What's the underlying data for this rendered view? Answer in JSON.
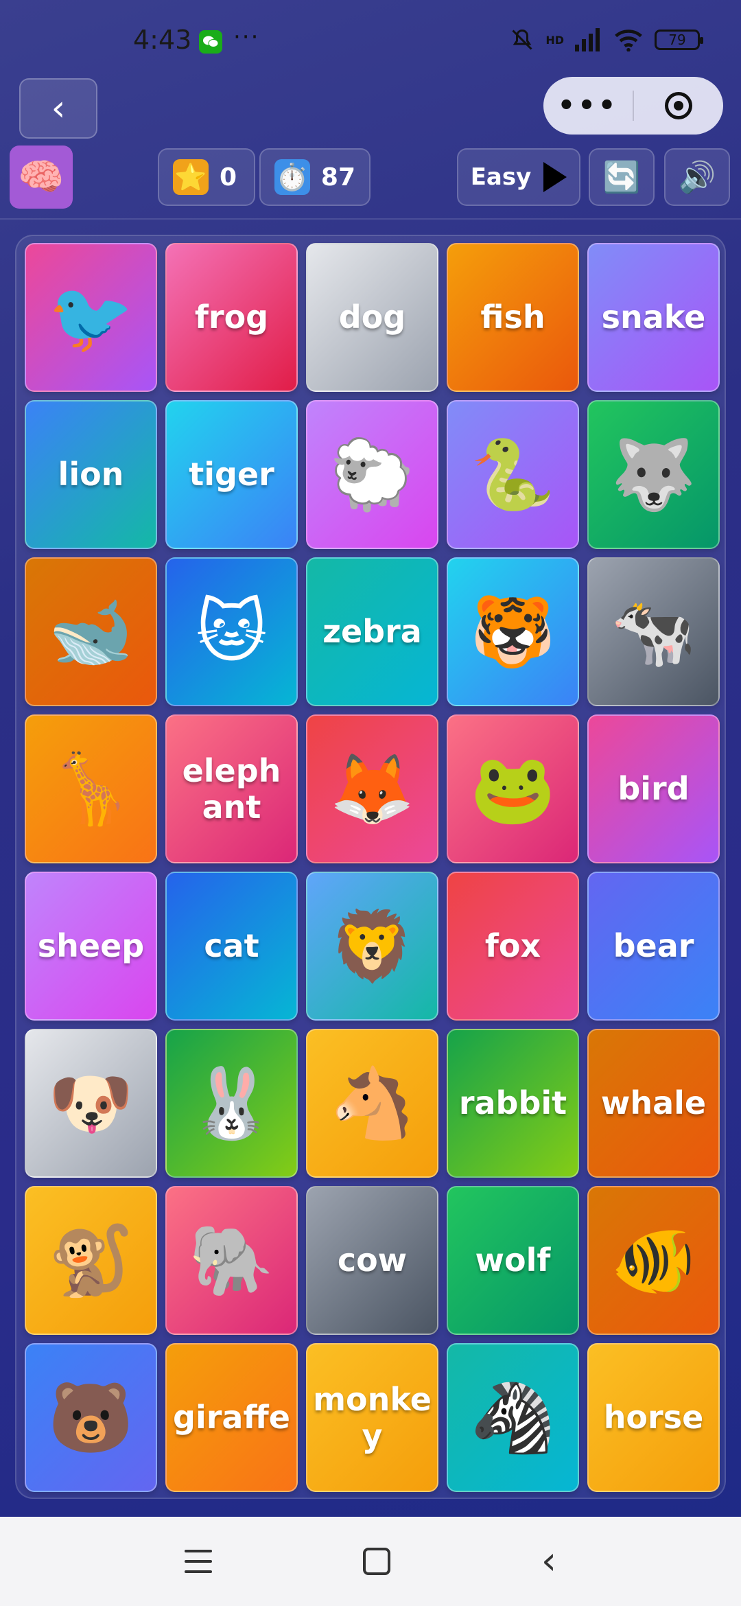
{
  "status_bar": {
    "time": "4:43",
    "dots": "···",
    "network": "HD",
    "battery": "79"
  },
  "header": {
    "back_glyph": "‹",
    "capsule_more": "•••"
  },
  "toolbar": {
    "brain_icon": "🧠",
    "score_icon": "⭐",
    "score": "0",
    "timer_icon": "⏱️",
    "timer": "87",
    "difficulty": "Easy",
    "refresh_icon": "🔄",
    "sound_icon": "🔊"
  },
  "cards": [
    {
      "kind": "emoji",
      "text": "🐦",
      "color": "pinkviolet"
    },
    {
      "kind": "word",
      "text": "frog",
      "color": "pink"
    },
    {
      "kind": "word",
      "text": "dog",
      "color": "silver"
    },
    {
      "kind": "word",
      "text": "fish",
      "color": "orange"
    },
    {
      "kind": "word",
      "text": "snake",
      "color": "violet"
    },
    {
      "kind": "word",
      "text": "lion",
      "color": "blueteal"
    },
    {
      "kind": "word",
      "text": "tiger",
      "color": "sky"
    },
    {
      "kind": "emoji",
      "text": "🐑",
      "color": "purple"
    },
    {
      "kind": "emoji",
      "text": "🐍",
      "color": "violet"
    },
    {
      "kind": "emoji",
      "text": "🐺",
      "color": "green"
    },
    {
      "kind": "emoji",
      "text": "🐋",
      "color": "orangered"
    },
    {
      "kind": "emoji",
      "text": "🐱",
      "color": "blue"
    },
    {
      "kind": "word",
      "text": "zebra",
      "color": "teal"
    },
    {
      "kind": "emoji",
      "text": "🐯",
      "color": "sky"
    },
    {
      "kind": "emoji",
      "text": "🐄",
      "color": "gray"
    },
    {
      "kind": "emoji",
      "text": "🦒",
      "color": "amber"
    },
    {
      "kind": "word",
      "text": "elephant",
      "color": "rose"
    },
    {
      "kind": "emoji",
      "text": "🦊",
      "color": "red"
    },
    {
      "kind": "emoji",
      "text": "🐸",
      "color": "rose"
    },
    {
      "kind": "word",
      "text": "bird",
      "color": "pinkviolet"
    },
    {
      "kind": "word",
      "text": "sheep",
      "color": "purple"
    },
    {
      "kind": "word",
      "text": "cat",
      "color": "blue"
    },
    {
      "kind": "emoji",
      "text": "🦁",
      "color": "skyteal"
    },
    {
      "kind": "word",
      "text": "fox",
      "color": "red"
    },
    {
      "kind": "word",
      "text": "bear",
      "color": "indigo"
    },
    {
      "kind": "emoji",
      "text": "🐶",
      "color": "silver"
    },
    {
      "kind": "emoji",
      "text": "🐰",
      "color": "lime"
    },
    {
      "kind": "emoji",
      "text": "🐴",
      "color": "yellow"
    },
    {
      "kind": "word",
      "text": "rabbit",
      "color": "lime"
    },
    {
      "kind": "word",
      "text": "whale",
      "color": "orangered"
    },
    {
      "kind": "emoji",
      "text": "🐒",
      "color": "yellow"
    },
    {
      "kind": "emoji",
      "text": "🐘",
      "color": "rose"
    },
    {
      "kind": "word",
      "text": "cow",
      "color": "gray"
    },
    {
      "kind": "word",
      "text": "wolf",
      "color": "green"
    },
    {
      "kind": "emoji",
      "text": "🐠",
      "color": "orangered"
    },
    {
      "kind": "emoji",
      "text": "🐻",
      "color": "indigo2"
    },
    {
      "kind": "word",
      "text": "giraffe",
      "color": "amber"
    },
    {
      "kind": "word",
      "text": "monkey",
      "color": "yellow"
    },
    {
      "kind": "emoji",
      "text": "🦓",
      "color": "teal"
    },
    {
      "kind": "word",
      "text": "horse",
      "color": "yellow"
    }
  ],
  "nav": {
    "back_glyph": "‹"
  }
}
